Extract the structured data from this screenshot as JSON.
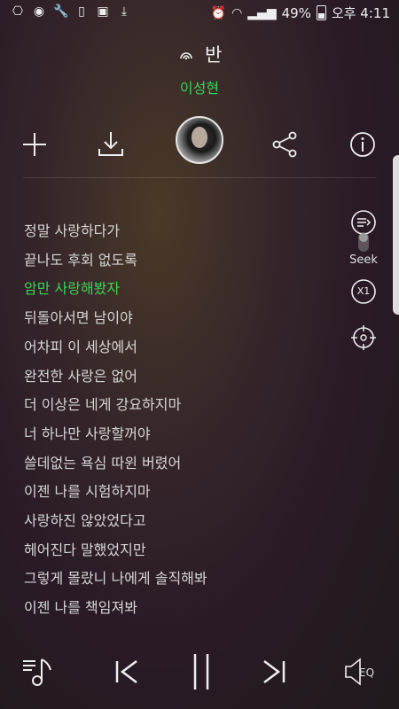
{
  "status_bar": {
    "battery": "49%",
    "time": "오후 4:11"
  },
  "song": {
    "title": "반",
    "artist": "이성현"
  },
  "lyrics": [
    "정말 사랑하다가",
    "끝나도 후회 없도록",
    "암만 사랑해봤자",
    "뒤돌아서면 남이야",
    "어차피 이 세상에서",
    "완전한 사랑은 없어",
    "더 이상은 네게 강요하지마",
    "너 하나만 사랑할꺼야",
    "쓸데없는 욕심 따윈 버렸어",
    "이젠 나를 시험하지마",
    "사랑하진 않았었다고",
    "헤어진다 말했었지만",
    "그렇게 몰랐니 나에게 솔직해봐",
    "이젠 나를 책임져봐"
  ],
  "current_lyric_index": 2,
  "side_controls": {
    "seek_label": "Seek",
    "speed_label": "X1"
  },
  "eq_label": "EQ",
  "colors": {
    "accent": "#39d353",
    "lyric": "#d6d6d6"
  }
}
